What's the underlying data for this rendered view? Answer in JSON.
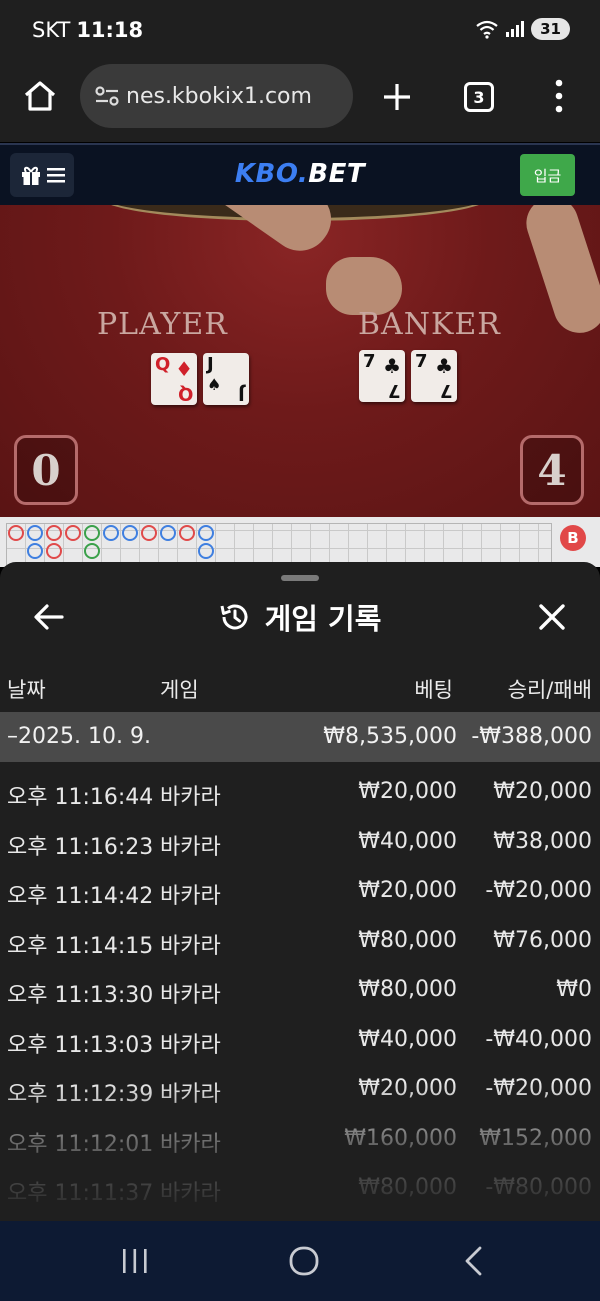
{
  "status_bar": {
    "carrier": "SKT",
    "time": "11:18",
    "battery": "31"
  },
  "browser": {
    "url": "nes.kbokix1.com",
    "tab_count": "3"
  },
  "site": {
    "logo_kbo": "KBO.",
    "logo_bet": "BET",
    "deposit_label": "입금"
  },
  "table": {
    "player_label": "PLAYER",
    "banker_label": "BANKER",
    "player_score": "0",
    "banker_score": "4",
    "player_cards": [
      {
        "rank": "Q",
        "suit": "♦"
      },
      {
        "rank": "J",
        "suit": "♠"
      }
    ],
    "banker_cards": [
      {
        "rank": "7",
        "suit": "♣"
      },
      {
        "rank": "7",
        "suit": "♣"
      }
    ],
    "roadmap_badge": "B"
  },
  "history": {
    "title": "게임 기록",
    "columns": {
      "date": "날짜",
      "game": "게임",
      "bet": "베팅",
      "result": "승리/패배"
    },
    "date_group": {
      "date": "–2025. 10. 9.",
      "bet_total": "₩8,535,000",
      "result_total": "-₩388,000"
    },
    "rows": [
      {
        "time": "오후 11:16:44",
        "game": "바카라",
        "bet": "₩20,000",
        "result": "₩20,000"
      },
      {
        "time": "오후 11:16:23",
        "game": "바카라",
        "bet": "₩40,000",
        "result": "₩38,000"
      },
      {
        "time": "오후 11:14:42",
        "game": "바카라",
        "bet": "₩20,000",
        "result": "-₩20,000"
      },
      {
        "time": "오후 11:14:15",
        "game": "바카라",
        "bet": "₩80,000",
        "result": "₩76,000"
      },
      {
        "time": "오후 11:13:30",
        "game": "바카라",
        "bet": "₩80,000",
        "result": "₩0"
      },
      {
        "time": "오후 11:13:03",
        "game": "바카라",
        "bet": "₩40,000",
        "result": "-₩40,000"
      },
      {
        "time": "오후 11:12:39",
        "game": "바카라",
        "bet": "₩20,000",
        "result": "-₩20,000"
      },
      {
        "time": "오후 11:12:01",
        "game": "바카라",
        "bet": "₩160,000",
        "result": "₩152,000"
      },
      {
        "time": "오후 11:11:37",
        "game": "바카라",
        "bet": "₩80,000",
        "result": "-₩80,000"
      }
    ]
  },
  "icons": {
    "home": "home-icon",
    "site_info": "tune-icon",
    "new_tab": "plus-icon",
    "more": "more-vert-icon",
    "gift": "gift-icon",
    "menu": "menu-icon",
    "back": "arrow-left-icon",
    "history": "history-icon",
    "close": "close-icon",
    "nav_recents": "recents-icon",
    "nav_home": "circle-home-icon",
    "nav_back": "chevron-left-icon"
  },
  "colors": {
    "deposit": "#3fa84a",
    "logo_accent": "#3c7ef2",
    "sheet_bg": "#1f1f1f",
    "date_row_bg": "#4a4a4a",
    "nav_bar": "#0d1a33"
  }
}
